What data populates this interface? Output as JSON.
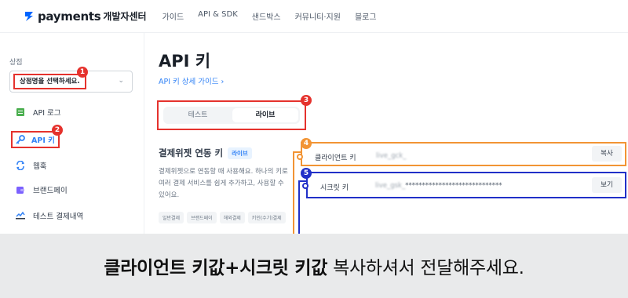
{
  "header": {
    "logo_name": "payments",
    "logo_sub": "개발자센터",
    "nav": [
      "가이드",
      "API & SDK",
      "샌드박스",
      "커뮤니티·지원",
      "블로그"
    ]
  },
  "sidebar": {
    "shop_label": "상점",
    "shop_select_value": "상점명을 선택하세요.",
    "items": [
      {
        "label": "API 로그",
        "icon": "document-icon"
      },
      {
        "label": "API 키",
        "icon": "key-icon"
      },
      {
        "label": "웹훅",
        "icon": "refresh-icon"
      },
      {
        "label": "브랜드페이",
        "icon": "wallet-icon"
      },
      {
        "label": "테스트 결제내역",
        "icon": "chart-icon"
      }
    ]
  },
  "main": {
    "title": "API 키",
    "guide_link": "API 키 상세 가이드 ›",
    "tabs": [
      "테스트",
      "라이브"
    ],
    "widget_title": "결제위젯 연동 키",
    "widget_tag": "라이브",
    "widget_desc": "결제위젯으로 연동할 때 사용해요. 하나의 키로 여러 결제 서비스를 쉽게 추가하고, 사용할 수 있어요.",
    "chips": [
      "일반결제",
      "브랜드페이",
      "해외결제",
      "키인(수기)결제"
    ],
    "client_key": {
      "label": "클라이언트 키",
      "value": "live_gck_",
      "button": "복사"
    },
    "secret_key": {
      "label": "시크릿 키",
      "value_prefix": "live_gsk_",
      "value_mask": "*****************************",
      "button": "보기"
    }
  },
  "markers": [
    "1",
    "2",
    "3",
    "4",
    "5"
  ],
  "caption": {
    "bold_part": "클라이언트 키값+시크릿 키값",
    "rest": " 복사하셔서 전달해주세요."
  },
  "colors": {
    "marker_red": "#e5322d",
    "marker_orange": "#f29434",
    "marker_blue": "#2130c8",
    "accent": "#3182f6"
  }
}
